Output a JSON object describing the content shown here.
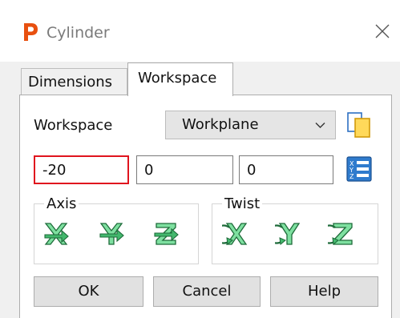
{
  "window": {
    "title": "Cylinder",
    "app_icon_letter": "P",
    "app_icon_color": "#e8500f"
  },
  "tabs": [
    {
      "label": "Dimensions",
      "active": false
    },
    {
      "label": "Workspace",
      "active": true
    }
  ],
  "workspace": {
    "label": "Workspace",
    "select_value": "Workplane"
  },
  "position": {
    "x": "-20",
    "y": "0",
    "z": "0",
    "highlight_color": "#e0141e"
  },
  "axis_group": {
    "legend": "Axis",
    "tools": [
      "rotate-x-icon",
      "rotate-y-icon",
      "rotate-z-icon"
    ]
  },
  "twist_group": {
    "legend": "Twist",
    "tools": [
      "twist-x-icon",
      "twist-y-icon",
      "twist-z-icon"
    ]
  },
  "buttons": {
    "ok": "OK",
    "cancel": "Cancel",
    "help": "Help"
  },
  "colors": {
    "icon_fill": "#7ee0a0",
    "icon_stroke": "#1e6b3a",
    "accent_blue": "#2d6fc2"
  }
}
